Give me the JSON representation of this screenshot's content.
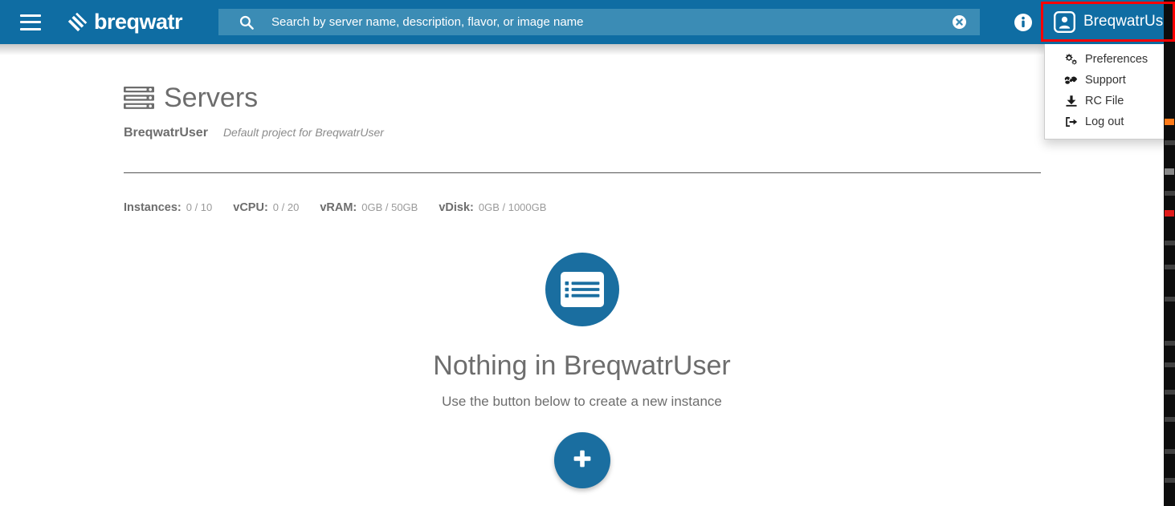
{
  "navbar": {
    "menu_icon": "hamburger-icon",
    "brand": "breqwatr",
    "brand_mark_icon": "breqwatr-logo-icon",
    "search": {
      "icon": "search-icon",
      "placeholder": "Search by server name, description, flavor, or image name",
      "value": "",
      "clear_icon": "clear-icon"
    },
    "info_icon": "info-icon",
    "user": {
      "avatar_icon": "user-avatar-icon",
      "name": "BreqwatrUser",
      "highlighted": true,
      "highlight_color": "#ff0000"
    }
  },
  "user_menu": {
    "open": true,
    "items": [
      {
        "label": "Preferences",
        "icon": "gears-icon"
      },
      {
        "label": "Support",
        "icon": "handshake-icon"
      },
      {
        "label": "RC File",
        "icon": "download-icon"
      },
      {
        "label": "Log out",
        "icon": "sign-out-icon"
      }
    ]
  },
  "page": {
    "title_icon": "servers-icon",
    "title": "Servers",
    "project_name": "BreqwatrUser",
    "project_description": "Default project for BreqwatrUser"
  },
  "quotas": [
    {
      "label": "Instances:",
      "value": "0 / 10"
    },
    {
      "label": "vCPU:",
      "value": "0 / 20"
    },
    {
      "label": "vRAM:",
      "value": "0GB / 50GB"
    },
    {
      "label": "vDisk:",
      "value": "0GB / 1000GB"
    }
  ],
  "empty_state": {
    "icon": "server-list-icon",
    "title": "Nothing in BreqwatrUser",
    "subtitle": "Use the button below to create a new instance",
    "create_button_icon": "plus-icon",
    "create_button_label": "+"
  },
  "colors": {
    "navbar_blue": "#0f6da3",
    "search_blue": "#3b8cb5",
    "accent_blue": "#1a6ea0",
    "text_gray": "#6d6d6d",
    "muted_gray": "#9a9a9a",
    "highlight_red": "#ff0000"
  }
}
